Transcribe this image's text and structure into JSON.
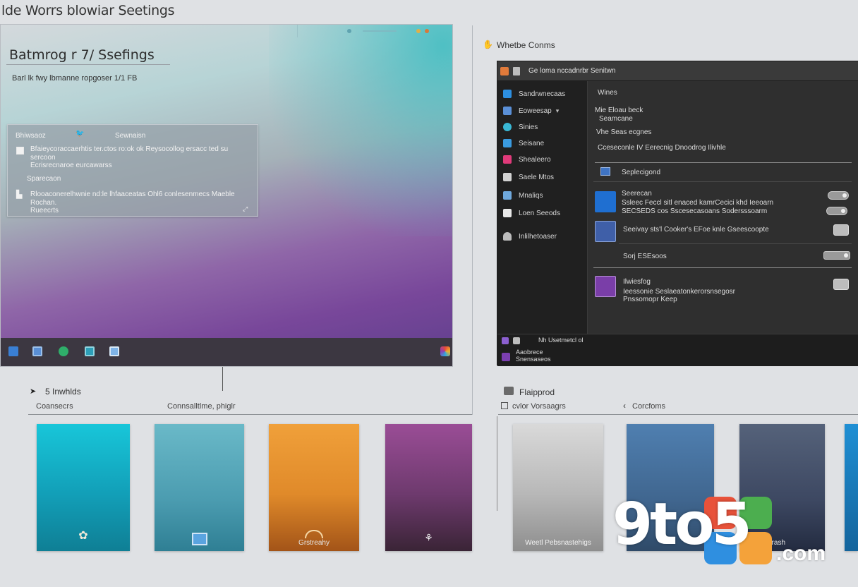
{
  "page": {
    "title": "lde Worrs blowiar Seetings"
  },
  "left_window": {
    "heading": "Batmrog r 7/ Ssefings",
    "subtitle": "Barl lk fwy lbmanne ropgoser 1/1 FB",
    "card": {
      "tab1": "Bhiwsaoz",
      "tab2": "Sewnaisn",
      "row1_line1": "Bfaieycoraccaerhtis ter.ctos ro:ok  ok Reysocollog ersacc ted su",
      "row1_line2": "sercoon",
      "row1_line3": "Ecrisrecnaroe eurcawarss",
      "section": "Sparecaon",
      "row2_line1": "Rlooaconerelhwnie nd:le lhfaaceatas Ohl6 conlesenmecs Maeble",
      "row2_line2": "Rochan.",
      "row2_line3": "Rueecrts"
    },
    "taskbar_icons": [
      "start-icon",
      "explorer-icon",
      "edge-icon",
      "store-icon",
      "mail-icon"
    ],
    "tray_icon": "colorful-tray-icon",
    "accent": "#4fc0c4"
  },
  "left_footer": {
    "label": "5 Inwhlds",
    "sub1": "Coansecrs",
    "sub2": "Connsalltlme, phiglr"
  },
  "right_window": {
    "outer_label": "Whetbe Conms",
    "titlebar": "Ge loma nccadnrbr Senitwn",
    "sidebar": [
      {
        "label": "Sandrwnecaas",
        "icon": "palette-icon",
        "color": "#2d8fe0"
      },
      {
        "label": "Eoweesap",
        "icon": "image-icon",
        "color": "#5a8fd6"
      },
      {
        "label": "Sinies",
        "icon": "color-icon",
        "color": "#39b7d4"
      },
      {
        "label": "Seisane",
        "icon": "brush-icon",
        "color": "#3a9be0"
      },
      {
        "label": "Shealeero",
        "icon": "theme-icon",
        "color": "#e03a7a"
      },
      {
        "label": "Saele Mtos",
        "icon": "lock-icon",
        "color": "#d2d2d2"
      },
      {
        "label": "Mnaliqs",
        "icon": "start-icon",
        "color": "#6fa8dc"
      },
      {
        "label": "Loen Seeods",
        "icon": "taskbar-icon",
        "color": "#e8e8e8"
      },
      {
        "label": "Inlilhetoaser",
        "icon": "user-icon",
        "color": "#bcbcbc"
      }
    ],
    "main": {
      "heading": "Wines",
      "line1": "Mie Eloau beck",
      "line2": "Seamcane",
      "line3": "Vhe Seas ecgnes",
      "line4": "Cceseconle IV Eerecnig  Dnoodrog Ilivhle",
      "group_label": "Seplecigond",
      "options": [
        {
          "title": "Seerecan",
          "desc": "Ssleec Feccl sitl enaced kamrCecici khd Ieeoarn",
          "desc2": "SECSEDS cos Sscesecasoans Sodersssoarm",
          "icon": "accent-color-icon",
          "color": "#1f6fd1"
        },
        {
          "title": "Seeivay sts'l Cooker's EFoe knle Gseescoopte",
          "desc": "",
          "desc2": "",
          "icon": "transparency-icon",
          "color": "#3f5fa8"
        },
        {
          "title": "Sorj ESEsoos",
          "desc": "",
          "desc2": "",
          "icon": "",
          "color": ""
        },
        {
          "title": "Ilwiesfog",
          "desc": "Ieessonie Seslaeatonkerorsnsegosr",
          "desc2": "Pnssomopr Keep",
          "icon": "contrast-icon",
          "color": "#7a3ea8"
        }
      ]
    },
    "bottom": {
      "line1": "Nh Usetmetcl ol",
      "line2": "Aaobrece",
      "line3": "Snensaseos"
    }
  },
  "right_footer": {
    "label": "Flaipprod",
    "sub1": "cvlor Vorsaagrs",
    "sub2": "Corcfoms",
    "back_icon": "chevron-left-icon"
  },
  "thumbnails": [
    {
      "caption": "",
      "icon": "flower-icon",
      "color": "#1fc0d4"
    },
    {
      "caption": "",
      "icon": "window-icon",
      "color": "#62b8c6"
    },
    {
      "caption": "Grstreahy",
      "icon": "arc-icon",
      "color": "#f39a2a"
    },
    {
      "caption": "",
      "icon": "figure-icon",
      "color": "#a14f98"
    },
    {
      "caption": "Weetl Pebsnastehigs",
      "icon": "",
      "color": "#bfbfbf"
    },
    {
      "caption": "",
      "icon": "",
      "color": "#4f7fb0"
    },
    {
      "caption": "arash",
      "icon": "",
      "color": "#53627c"
    },
    {
      "caption": "",
      "icon": "",
      "color": "#1f7fc4"
    }
  ],
  "watermark": {
    "text": "9to5",
    "suffix": ".com"
  }
}
